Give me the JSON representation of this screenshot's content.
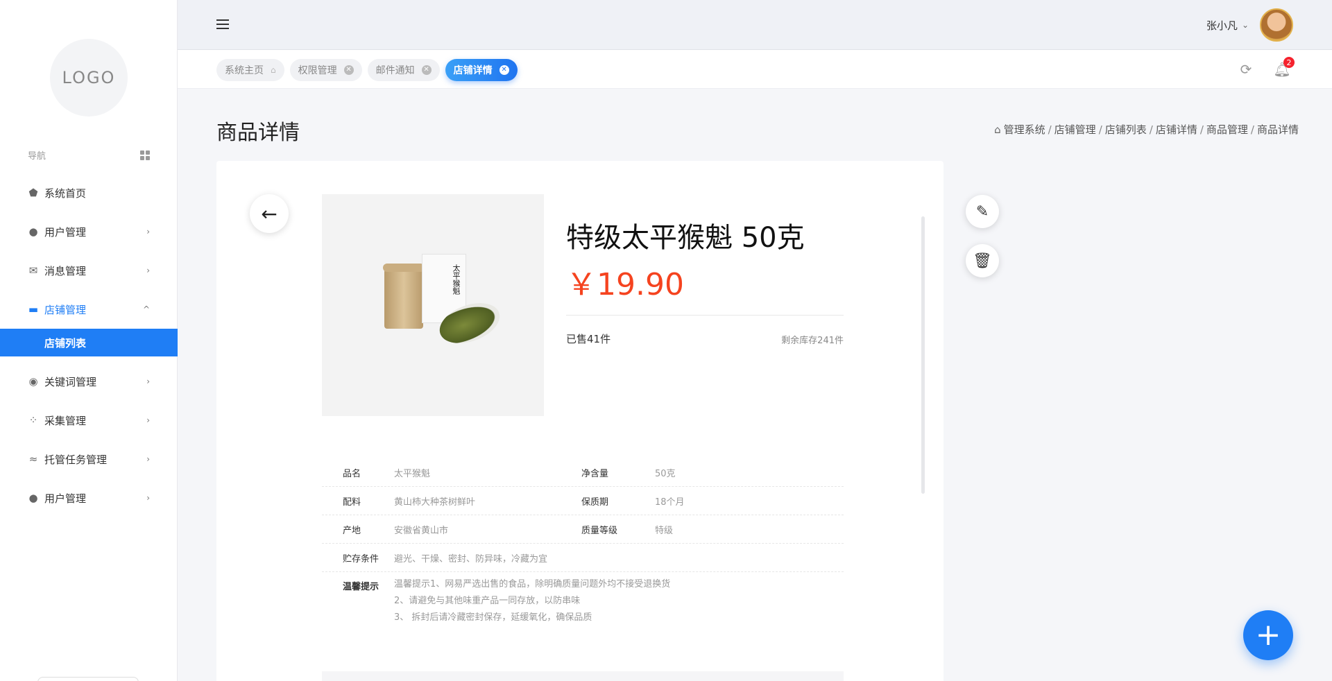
{
  "sidebar": {
    "logo": "LOGO",
    "nav_label": "导航",
    "items": [
      {
        "label": "系统首页",
        "chevron": ""
      },
      {
        "label": "用户管理",
        "chevron": "›"
      },
      {
        "label": "消息管理",
        "chevron": "›"
      },
      {
        "label": "店铺管理",
        "chevron": "^"
      },
      {
        "label": "店铺列表"
      },
      {
        "label": "关键词管理",
        "chevron": "›"
      },
      {
        "label": "采集管理",
        "chevron": "›"
      },
      {
        "label": "托管任务管理",
        "chevron": "›"
      },
      {
        "label": "用户管理",
        "chevron": "›"
      }
    ],
    "accent": "#1f7ef5"
  },
  "header": {
    "user_name": "张小凡",
    "dropdown_glyph": "⌄"
  },
  "tabs": [
    {
      "label": "系统主页"
    },
    {
      "label": "权限管理"
    },
    {
      "label": "邮件通知"
    },
    {
      "label": "店铺详情"
    }
  ],
  "notifications": {
    "count": "2"
  },
  "page": {
    "title": "商品详情",
    "breadcrumb": [
      "管理系统",
      "店铺管理",
      "店铺列表",
      "店铺详情",
      "商品管理",
      "商品详情"
    ]
  },
  "product": {
    "name": "特级太平猴魁 50克",
    "price": "￥19.90",
    "sold": "已售41件",
    "stock": "剩余库存241件",
    "box_text": "太平猴魁",
    "price_color": "#f5431f"
  },
  "specs": [
    {
      "k": "品名",
      "v": "太平猴魁",
      "k2": "净含量",
      "v2": "50克"
    },
    {
      "k": "配料",
      "v": "黄山柿大种茶树鲜叶",
      "k2": "保质期",
      "v2": "18个月"
    },
    {
      "k": "产地",
      "v": "安徽省黄山市",
      "k2": "质量等级",
      "v2": "特级"
    },
    {
      "k": "贮存条件",
      "v": "避光、干燥、密封、防异味，冷藏为宜",
      "k2": "",
      "v2": ""
    }
  ],
  "tips": {
    "label": "温馨提示",
    "lines": [
      "温馨提示1、网易严选出售的食品，除明确质量问题外均不接受退换货",
      "2、请避免与其他味重产品一同存放，以防串味",
      "3、 拆封后请冷藏密封保存，延缓氧化，确保品质"
    ]
  }
}
